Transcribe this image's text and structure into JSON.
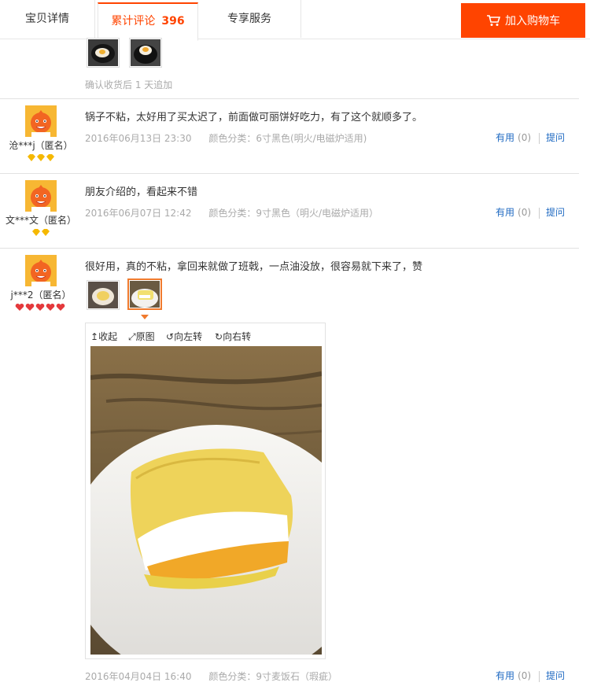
{
  "tabs": [
    {
      "label": "宝贝详情"
    },
    {
      "label": "累计评论",
      "count": "396"
    },
    {
      "label": "专享服务"
    }
  ],
  "cart_button": {
    "label": "加入购物车",
    "icon": "cart-icon"
  },
  "colors": {
    "accent": "#ff4400",
    "link": "#1f6ac2",
    "muted": "#aaaaaa"
  },
  "previous_review": {
    "append_note": "确认收货后 1 天追加"
  },
  "reviews": [
    {
      "author": "沧***j（匿名）",
      "rank_icons": "3 gold diamonds",
      "content": "锅子不粘，太好用了买太迟了，前面做可丽饼好吃力，有了这个就顺多了。",
      "date": "2016年06月13日 23:30",
      "sku": "颜色分类：6寸黑色(明火/电磁炉适用)",
      "useful_label": "有用",
      "useful_count": "(0)",
      "ask_label": "提问"
    },
    {
      "author": "文***文（匿名）",
      "rank_icons": "2 gold diamonds",
      "content": "朋友介绍的，看起来不错",
      "date": "2016年06月07日 12:42",
      "sku": "颜色分类：9寸黑色（明火/电磁炉适用）",
      "useful_label": "有用",
      "useful_count": "(0)",
      "ask_label": "提问"
    },
    {
      "author": "j***2（匿名）",
      "rank_icons": "5 red hearts",
      "content": "很好用，真的不粘，拿回来就做了班戟，一点油没放，很容易就下来了，赞",
      "date": "2016年04月04日 16:40",
      "sku": "颜色分类：9寸麦饭石（瑕疵）",
      "useful_label": "有用",
      "useful_count": "(0)",
      "ask_label": "提问"
    }
  ],
  "viewer": {
    "collapse": "收起",
    "original": "原图",
    "rotate_left": "向左转",
    "rotate_right": "向右转"
  }
}
